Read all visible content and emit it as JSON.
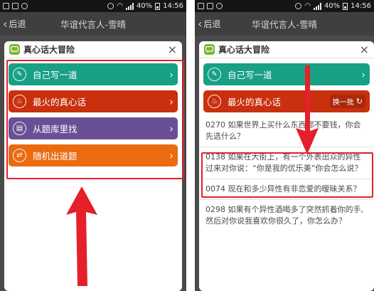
{
  "status_bar": {
    "battery": "40%",
    "time": "14:56"
  },
  "header": {
    "back_label": "后退",
    "title": "华谊代言人-雪晴"
  },
  "dialog": {
    "title": "真心话大冒险",
    "close_symbol": "×"
  },
  "menu": [
    {
      "label": "自己写一道",
      "color": "#18a084",
      "icon": "pencil-icon"
    },
    {
      "label": "最火的真心话",
      "color": "#c9300e",
      "icon": "flame-icon"
    },
    {
      "label": "从题库里找",
      "color": "#6a4f96",
      "icon": "book-icon"
    },
    {
      "label": "随机出道题",
      "color": "#ea6b10",
      "icon": "shuffle-icon"
    }
  ],
  "right_panel": {
    "refresh_label": "换一批",
    "questions": [
      "0270 如果世界上买什么东西都不要钱，你会先选什么？",
      "0138 如果在大街上，有一个外表出众的异性过来对你说：“你是我的优乐美”你会怎么说？",
      "0074 现在和多少异性有非恋爱的暧昧关系？",
      "0298 如果有个异性酒喝多了突然抓着你的手,然后对你说我喜欢你很久了，你怎么办？"
    ]
  },
  "annotation_color": "#e5202a"
}
